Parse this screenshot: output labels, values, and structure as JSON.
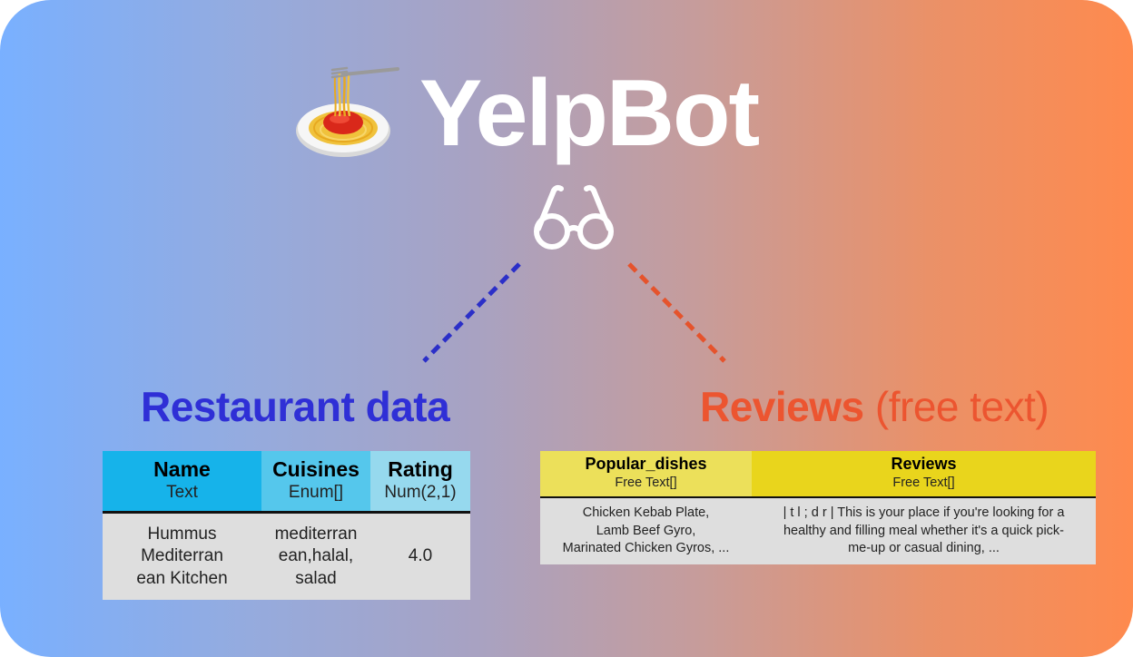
{
  "title": "YelpBot",
  "icons": {
    "logo": "spaghetti-icon",
    "glasses": "glasses-icon"
  },
  "colors": {
    "left_heading": "#2f2fd6",
    "right_heading": "#ec5530",
    "left_line": "#2b2fc8",
    "right_line": "#e5532c"
  },
  "left": {
    "heading": "Restaurant data",
    "columns": [
      {
        "name": "Name",
        "type": "Text",
        "color": "#16b3ea"
      },
      {
        "name": "Cuisines",
        "type": "Enum[]",
        "color": "#55c7ec"
      },
      {
        "name": "Rating",
        "type": "Num(2,1)",
        "color": "#96d9ee"
      }
    ],
    "row": {
      "name_lines": [
        "Hummus",
        "Mediterran",
        "ean Kitchen"
      ],
      "cuisines_lines": [
        "mediterran",
        "ean,halal,",
        "salad"
      ],
      "rating": "4.0"
    }
  },
  "right": {
    "heading": "Reviews",
    "heading_suffix": "(free text)",
    "columns": [
      {
        "name": "Popular_dishes",
        "type": "Free Text[]",
        "color": "#ece05a"
      },
      {
        "name": "Reviews",
        "type": "Free Text[]",
        "color": "#e9d51c"
      }
    ],
    "row": {
      "dishes_lines": [
        "Chicken Kebab Plate,",
        "Lamb Beef Gyro,",
        "Marinated Chicken Gyros, ..."
      ],
      "review_lines": [
        "| t l ; d r | This is your place if you're looking for a",
        "healthy and filling meal whether it's a quick pick-",
        "me-up or casual dining, ..."
      ]
    }
  }
}
